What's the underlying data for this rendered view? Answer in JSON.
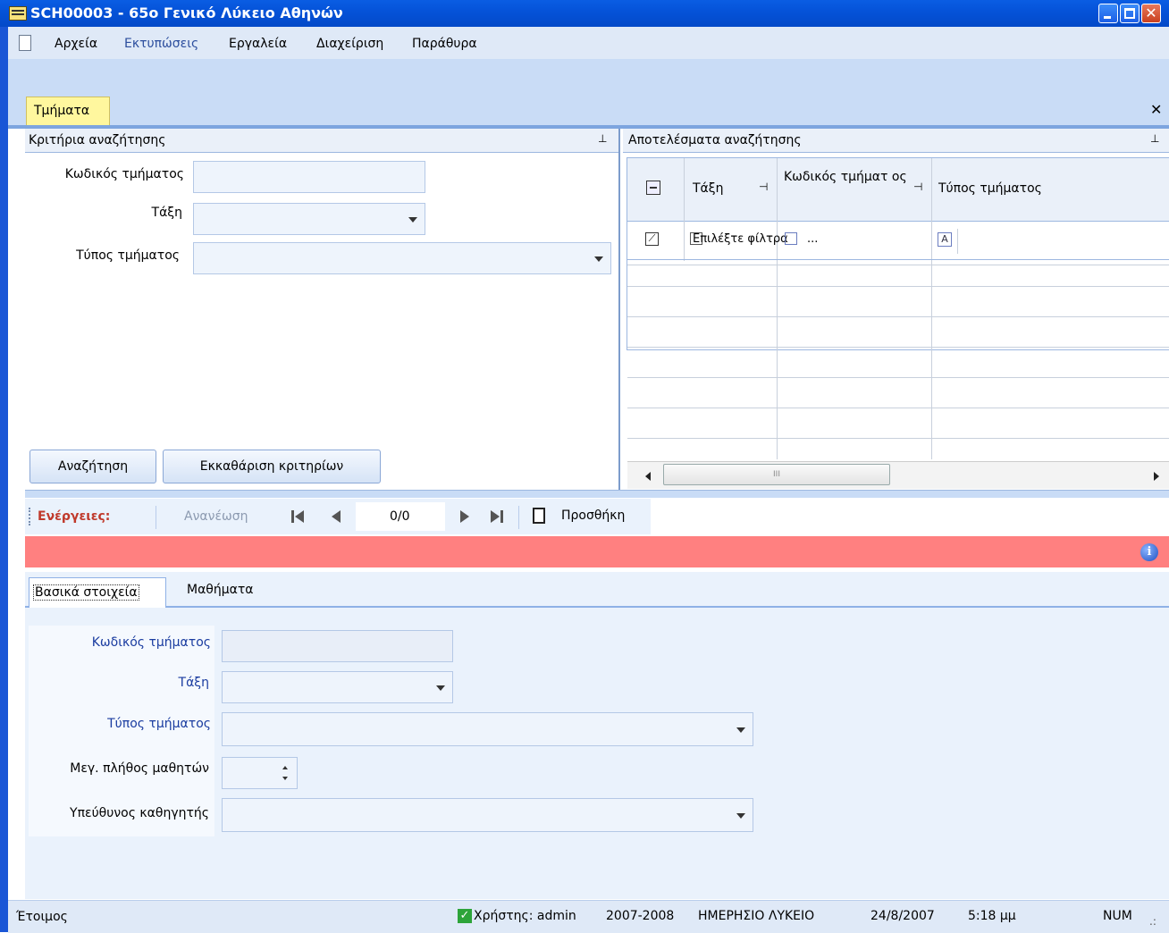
{
  "window": {
    "title": "SCH00003 - 65ο Γενικό Λύκειο Αθηνών"
  },
  "menu": [
    "Αρχεία",
    "Εκτυπώσεις",
    "Εργαλεία",
    "Διαχείριση",
    "Παράθυρα"
  ],
  "doc_tab": "Τμήματα",
  "search_panel": {
    "header": "Κριτήρια αναζήτησης",
    "fields": {
      "code_label": "Κωδικός τμήματος",
      "class_label": "Τάξη",
      "type_label": "Τύπος τμήματος"
    },
    "search_button": "Αναζήτηση",
    "clear_button": "Εκκαθάριση κριτηρίων"
  },
  "results_panel": {
    "header": "Αποτελέσματα αναζήτησης",
    "columns": [
      "Τάξη",
      "Κωδικός τμήματ ος",
      "Τύπος τμήματος"
    ],
    "filter_text": "Επιλέξτε φίλτρα",
    "filter_ellipsis": "...",
    "scroll_mark": "III"
  },
  "actions": {
    "label": "Ενέργειες:",
    "refresh": "Ανανέωση",
    "record_position": "0/0",
    "add": "Προσθήκη"
  },
  "detail_tabs": [
    "Βασικά στοιχεία",
    "Μαθήματα"
  ],
  "detail_form": {
    "code_label": "Κωδικός τμήματος",
    "class_label": "Τάξη",
    "type_label": "Τύπος τμήματος",
    "max_students_label": "Μεγ. πλήθος μαθητών",
    "teacher_label": "Υπεύθυνος καθηγητής"
  },
  "status": {
    "ready": "Έτοιμος",
    "user": "Χρήστης: admin",
    "year": "2007-2008",
    "school_type": "ΗΜΕΡΗΣΙΟ ΛΥΚΕΙΟ",
    "date": "24/8/2007",
    "time": "5:18 μμ",
    "num": "NUM"
  },
  "colors": {
    "title_bar": "#0553d9",
    "error_bar": "#ff8080",
    "active_tab": "#fff79e",
    "action_label": "#c0392b",
    "form_label": "#1a3ca0"
  }
}
